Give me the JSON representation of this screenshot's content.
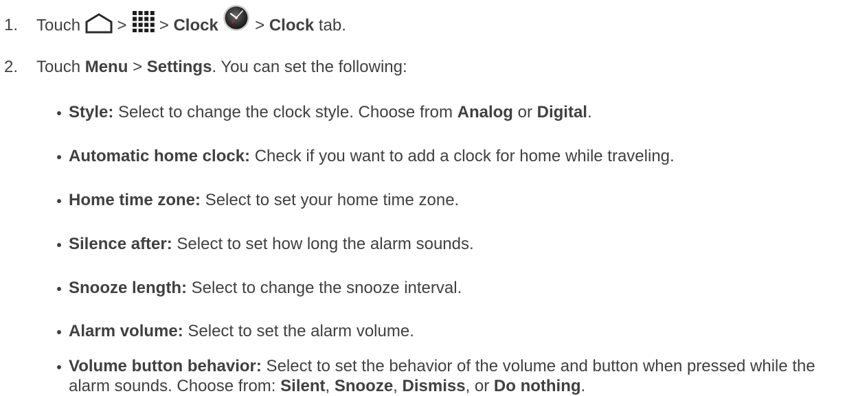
{
  "steps": [
    {
      "number": "1.",
      "touch": "Touch",
      "sep1": ">",
      "sep2": ">",
      "clock_bold": "Clock",
      "sep3": ">",
      "clock_tab_bold": "Clock",
      "tab_text": "tab."
    },
    {
      "number": "2.",
      "touch": "Touch",
      "menu_bold": "Menu",
      "sep": ">",
      "settings_bold": "Settings",
      "rest": ". You can set the following:"
    }
  ],
  "icons": {
    "home": "home-icon",
    "apps": "apps-grid-icon",
    "clock": "clock-app-icon"
  },
  "settings": [
    {
      "term": "Style:",
      "text": " Select to change the clock style. Choose from ",
      "opt1": "Analog",
      "mid": " or ",
      "opt2": "Digital",
      "end": "."
    },
    {
      "term": "Automatic home clock:",
      "text": " Check if you want to add a clock for home while traveling."
    },
    {
      "term": "Home time zone:",
      "text": " Select to set your home time zone."
    },
    {
      "term": "Silence after:",
      "text": " Select to set how long the alarm sounds."
    },
    {
      "term": "Snooze length:",
      "text": " Select to change the snooze interval."
    },
    {
      "term": "Alarm volume:",
      "text": " Select to set the alarm volume."
    },
    {
      "term": "Volume button behavior:",
      "text": " Select to set the behavior of the volume and button when pressed while the alarm sounds. Choose from: ",
      "opt1": "Silent",
      "c1": ", ",
      "opt2": "Snooze",
      "c2": ", ",
      "opt3": "Dismiss",
      "c3": ", or ",
      "opt4": "Do nothing",
      "end": "."
    }
  ]
}
